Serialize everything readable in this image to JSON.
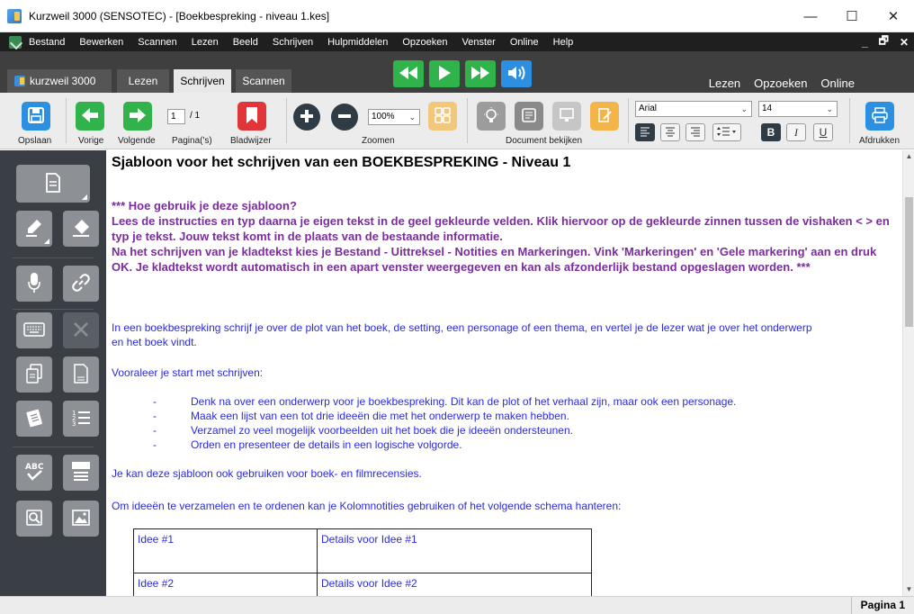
{
  "window": {
    "title": "Kurzweil 3000 (SENSOTEC) - [Boekbespreking - niveau 1.kes]",
    "controls": [
      "—",
      "☐",
      "✕"
    ]
  },
  "menubar": {
    "items": [
      "Bestand",
      "Bewerken",
      "Scannen",
      "Lezen",
      "Beeld",
      "Schrijven",
      "Hulpmiddelen",
      "Opzoeken",
      "Venster",
      "Online",
      "Help"
    ],
    "right_controls": [
      "_",
      "🗗",
      "✕"
    ]
  },
  "tabbar": {
    "brand": "kurzweil 3000",
    "tabs": [
      "Lezen",
      "Schrijven",
      "Scannen"
    ],
    "active_tab": "Schrijven",
    "right_links": [
      "Lezen",
      "Opzoeken",
      "Online"
    ]
  },
  "toolbar": {
    "labels": {
      "save": "Opslaan",
      "prev": "Vorige",
      "next": "Volgende",
      "pages": "Pagina('s)",
      "bookmark": "Bladwijzer",
      "zoom": "Zoomen",
      "document_view": "Document bekijken",
      "print": "Afdrukken"
    },
    "page_current": "1",
    "page_total": "/ 1",
    "zoom_value": "100%",
    "font_name": "Arial",
    "font_size": "14",
    "format_buttons": {
      "bold": "B",
      "italic": "I",
      "underline": "U"
    }
  },
  "document": {
    "title": "Sjabloon voor het schrijven van een BOEKBESPREKING - Niveau 1",
    "instructions": [
      "*** Hoe gebruik je deze sjabloon?",
      "Lees de instructies en typ daarna je eigen tekst in de geel gekleurde velden. Klik hiervoor op de gekleurde zinnen tussen de vishaken < > en typ je tekst. Jouw tekst komt in de plaats van de bestaande informatie.",
      "Na het schrijven van je kladtekst kies je Bestand - Uittreksel - Notities en Markeringen. Vink 'Markeringen' en 'Gele markering' aan en druk OK. Je kladtekst wordt automatisch in een apart venster weergegeven en kan als afzonderlijk bestand opgeslagen worden. ***"
    ],
    "intro": "In een boekbespreking schrijf je over de plot van het boek, de setting, een personage of een thema, en vertel je de lezer wat je over het onderwerp en het boek vindt.",
    "before_start": "Vooraleer je start met schrijven:",
    "bullets": [
      "Denk na over een onderwerp voor je boekbespreking. Dit kan de plot of het verhaal zijn, maar ook een personage.",
      "Maak een lijst van een tot drie ideeën die met het onderwerp te maken hebben.",
      "Verzamel zo veel mogelijk voorbeelden uit het boek die je ideeën ondersteunen.",
      "Orden en presenteer de details in een logische volgorde."
    ],
    "bullet_marker": "-",
    "also_use": "Je kan deze sjabloon ook gebruiken voor boek- en filmrecensies.",
    "columns_intro": "Om ideeën te verzamelen en te ordenen kan je Kolomnotities gebruiken of het volgende schema hanteren:",
    "table": [
      [
        "Idee #1",
        "Details voor Idee #1"
      ],
      [
        "Idee #2",
        "Details voor Idee #2"
      ]
    ]
  },
  "statusbar": {
    "page": "Pagina 1"
  },
  "colors": {
    "instructions": "#7b2c9e",
    "body_text": "#2b2bdc",
    "play_green": "#2fb34a",
    "sidebar": "#3a3f45"
  }
}
